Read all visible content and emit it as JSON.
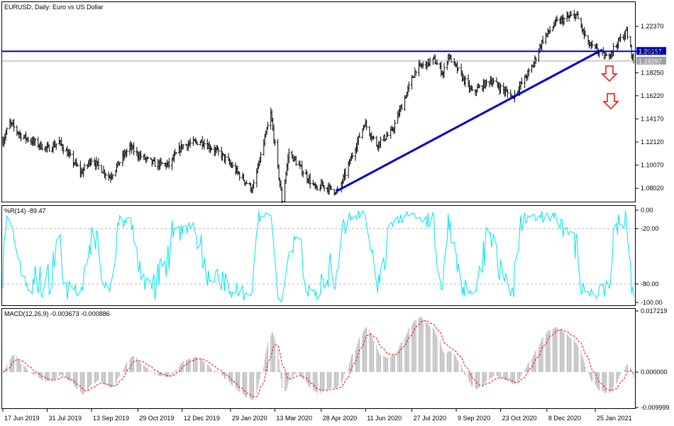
{
  "colors": {
    "background": "#ffffff",
    "frame": "#000000",
    "candles": "#000000",
    "resistance_line": "#0000cc",
    "trend_line": "#0000cc",
    "current_price_line": "#a0a0a0",
    "wpr_line": "#00e5ee",
    "level_lines": "#b4b4b4",
    "macd_histogram": "#b4b4b4",
    "macd_signal": "#ff0000",
    "arrows": "#ff0000",
    "resistance_tag_bg": "#0000cc",
    "current_tag_bg": "#a0a0a0"
  },
  "chart_data": [
    {
      "type": "candlestick",
      "title": "EURUSD, Daily:  Euro vs US Dollar",
      "ylim": [
        1.069,
        1.2445
      ],
      "y_ticks": [
        "1.22370",
        "1.20157",
        "1.18250",
        "1.16220",
        "1.14170",
        "1.12120",
        "1.10070",
        "1.08020"
      ],
      "x_ticks": [
        "17 Jun 2019",
        "31 Jul 2019",
        "13 Sep 2019",
        "29 Oct 2019",
        "12 Dec 2019",
        "29 Jan 2020",
        "13 Mar 2020",
        "28 Apr 2020",
        "11 Jun 2020",
        "27 Jul 2020",
        "9 Sep 2020",
        "23 Oct 2020",
        "8 Dec 2020",
        "25 Jan 2021"
      ],
      "close_path": [
        [
          "17 Jun 2019",
          1.122
        ],
        [
          "24 Jun 2019",
          1.138
        ],
        [
          "5 Jul 2019",
          1.127
        ],
        [
          "31 Jul 2019",
          1.115
        ],
        [
          "12 Aug 2019",
          1.121
        ],
        [
          "3 Sep 2019",
          1.094
        ],
        [
          "13 Sep 2019",
          1.106
        ],
        [
          "1 Oct 2019",
          1.09
        ],
        [
          "21 Oct 2019",
          1.117
        ],
        [
          "29 Oct 2019",
          1.11
        ],
        [
          "14 Nov 2019",
          1.102
        ],
        [
          "29 Nov 2019",
          1.101
        ],
        [
          "12 Dec 2019",
          1.118
        ],
        [
          "31 Dec 2019",
          1.122
        ],
        [
          "20 Jan 2020",
          1.11
        ],
        [
          "29 Jan 2020",
          1.101
        ],
        [
          "20 Feb 2020",
          1.079
        ],
        [
          "9 Mar 2020",
          1.146
        ],
        [
          "20 Mar 2020",
          1.07
        ],
        [
          "27 Mar 2020",
          1.112
        ],
        [
          "24 Apr 2020",
          1.078
        ],
        [
          "28 Apr 2020",
          1.083
        ],
        [
          "15 May 2020",
          1.077
        ],
        [
          "10 Jun 2020",
          1.138
        ],
        [
          "22 Jun 2020",
          1.119
        ],
        [
          "7 Jul 2020",
          1.13
        ],
        [
          "31 Jul 2020",
          1.186
        ],
        [
          "18 Aug 2020",
          1.194
        ],
        [
          "27 Aug 2020",
          1.182
        ],
        [
          "1 Sep 2020",
          1.198
        ],
        [
          "25 Sep 2020",
          1.165
        ],
        [
          "13 Oct 2020",
          1.176
        ],
        [
          "4 Nov 2020",
          1.161
        ],
        [
          "23 Nov 2020",
          1.187
        ],
        [
          "4 Dec 2020",
          1.212
        ],
        [
          "17 Dec 2020",
          1.227
        ],
        [
          "6 Jan 2021",
          1.234
        ],
        [
          "18 Jan 2021",
          1.208
        ],
        [
          "5 Feb 2021",
          1.196
        ],
        [
          "25 Feb 2021",
          1.219
        ],
        [
          "4 Mar 2021",
          1.1929
        ]
      ],
      "horizontal_levels": [
        {
          "value": 1.20157,
          "label": "1.20157",
          "style": "resistance"
        },
        {
          "value": 1.19297,
          "label": "1.19297",
          "style": "current"
        }
      ],
      "trend_line": {
        "from": [
          "13 May 2020",
          1.0775
        ],
        "to": [
          "1 Feb 2021",
          1.203
        ]
      },
      "annotations": [
        "down-arrow",
        "down-arrow"
      ]
    },
    {
      "type": "line",
      "title": "%R(14) -89.47",
      "ylim": [
        -100,
        0
      ],
      "y_ticks": [
        "0.00",
        "-20.00",
        "-80.00",
        "-100.00"
      ],
      "levels": [
        -20,
        -80
      ]
    },
    {
      "type": "bar",
      "title": "MACD(12,26,9) -0.003673 -0.000886",
      "ylim": [
        -0.009999,
        0.017219
      ],
      "y_ticks": [
        "0.017219",
        "0.000000",
        "-0.009999"
      ],
      "series": [
        {
          "name": "MACD",
          "style": "histogram"
        },
        {
          "name": "Signal",
          "style": "dashed-line"
        }
      ]
    }
  ]
}
